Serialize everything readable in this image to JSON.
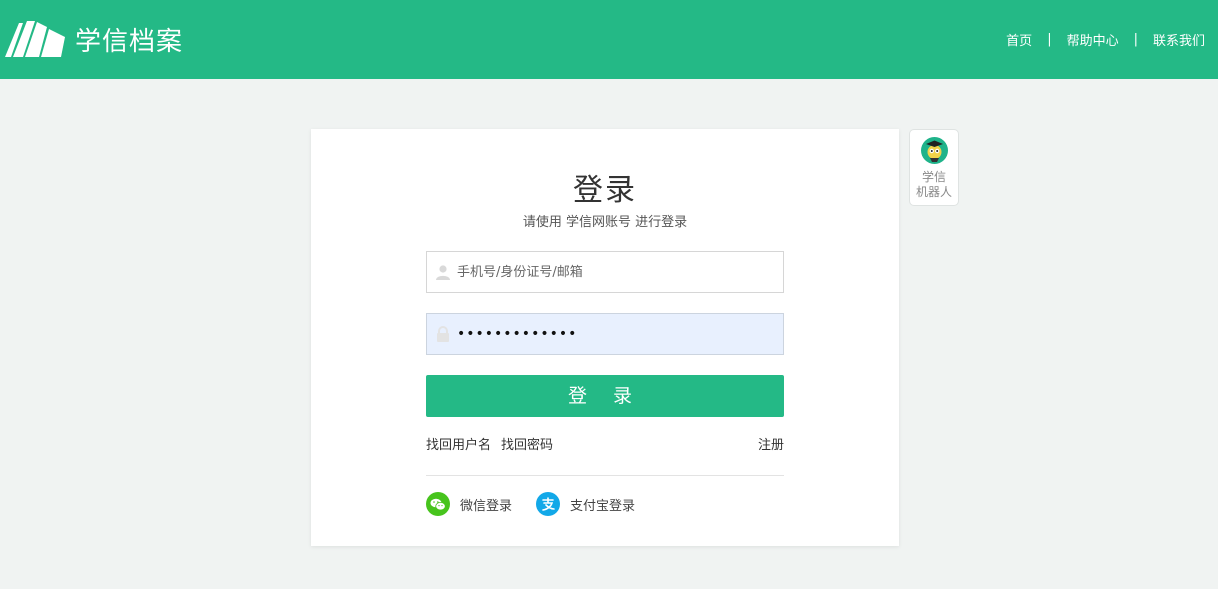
{
  "header": {
    "logo_text": "学信档案",
    "nav": [
      {
        "label": "首页"
      },
      {
        "label": "帮助中心"
      },
      {
        "label": "联系我们"
      }
    ],
    "separator": "|",
    "bg_color": "#24b986"
  },
  "login": {
    "title": "登录",
    "subtitle": "请使用 学信网账号 进行登录",
    "username_placeholder": "手机号/身份证号/邮箱",
    "password_value": "•••••••••••••",
    "submit_label": "登 录",
    "find_username": "找回用户名",
    "find_password": "找回密码",
    "register": "注册",
    "wechat_login": "微信登录",
    "alipay_login": "支付宝登录",
    "accent_color": "#24b986"
  },
  "robot": {
    "line1": "学信",
    "line2": "机器人"
  },
  "icons": {
    "logo": "book-pages-icon",
    "user": "user-icon",
    "lock": "lock-icon",
    "wechat": "wechat-icon",
    "alipay": "alipay-icon",
    "robot": "robot-avatar-icon"
  }
}
